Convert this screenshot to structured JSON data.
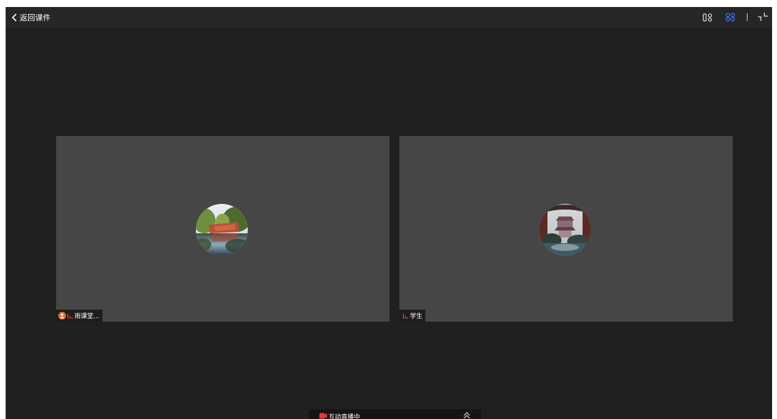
{
  "topbar": {
    "back_label": "返回课件",
    "view_modes": [
      "layout-speaker-icon",
      "layout-grid-icon",
      "divider-icon",
      "exit-fullscreen-icon"
    ],
    "active_view": "layout-grid-icon",
    "accent_color": "#3d7bff"
  },
  "participants": [
    {
      "name": "雨课堂...",
      "role_badge": "teacher-badge-icon",
      "mic_icon": "mic-level-icon",
      "avatar": "landscape-photo-avatar"
    },
    {
      "name": "学生",
      "mic_icon": "mic-level-icon",
      "avatar": "pavilion-photo-avatar"
    }
  ],
  "live_bar": {
    "status_text": "互动直播中",
    "status_color": "#e53935"
  }
}
